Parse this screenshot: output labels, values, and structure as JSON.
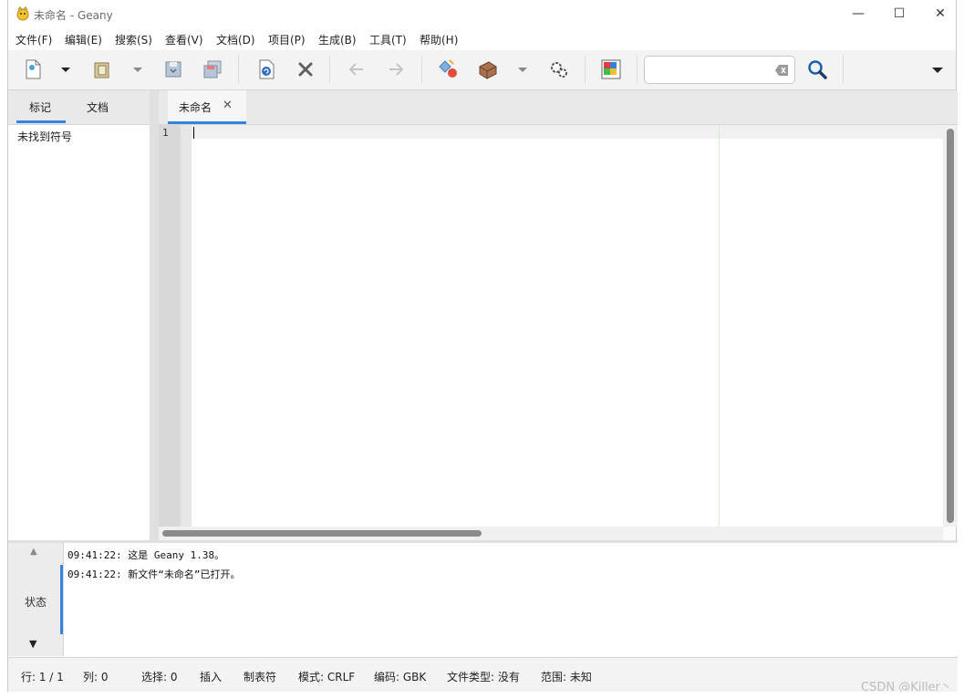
{
  "window": {
    "title": "未命名 - Geany",
    "minimize_glyph": "—",
    "maximize_glyph": "☐",
    "close_glyph": "✕"
  },
  "menubar": {
    "items": [
      "文件(F)",
      "编辑(E)",
      "搜索(S)",
      "查看(V)",
      "文档(D)",
      "项目(P)",
      "生成(B)",
      "工具(T)",
      "帮助(H)"
    ]
  },
  "toolbar": {
    "icons": [
      "new-file-icon",
      "open-file-icon",
      "save-icon",
      "save-all-icon",
      "reload-icon",
      "close-icon",
      "back-icon",
      "forward-icon",
      "compile-icon",
      "build-icon",
      "execute-icon",
      "color-chooser-icon",
      "search-icon"
    ],
    "search_value": ""
  },
  "sidebar": {
    "tabs": [
      "标记",
      "文档"
    ],
    "active_tab": "标记",
    "empty_text": "未找到符号"
  },
  "editor": {
    "tabs": [
      {
        "label": "未命名",
        "close": "✕"
      }
    ],
    "line_numbers": [
      "1"
    ]
  },
  "messages": {
    "label": "状态",
    "up_arrow": "▲",
    "down_arrow": "▼",
    "lines": [
      "09:41:22: 这是 Geany 1.38。",
      "09:41:22: 新文件“未命名”已打开。"
    ]
  },
  "statusbar": {
    "line": "行: 1 / 1",
    "col": "列: 0",
    "selection": "选择: 0",
    "insert_mode": "插入",
    "indent": "制表符",
    "eol_mode": "模式: CRLF",
    "encoding": "编码: GBK",
    "filetype": "文件类型: 没有",
    "scope": "范围: 未知"
  },
  "watermark": "CSDN @Killer丶",
  "colors": {
    "accent": "#3584e4",
    "toolbar_bg": "#f3f3f3",
    "gutter": "#d8d8d8"
  }
}
